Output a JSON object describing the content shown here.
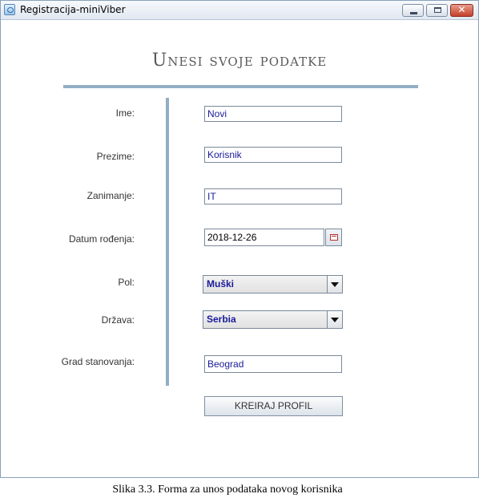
{
  "window": {
    "title": "Registracija-miniViber",
    "close_symbol": "✕"
  },
  "form": {
    "heading": "Unesi svoje podatke",
    "labels": {
      "ime": "Ime:",
      "prezime": "Prezime:",
      "zanimanje": "Zanimanje:",
      "datum": "Datum rođenja:",
      "pol": "Pol:",
      "drzava": "Država:",
      "grad": "Grad stanovanja:"
    },
    "values": {
      "ime": "Novi",
      "prezime": "Korisnik",
      "zanimanje": "IT",
      "datum": "2018-12-26",
      "pol": "Muški",
      "drzava": "Serbia",
      "grad": "Beograd"
    },
    "submit_label": "KREIRAJ PROFIL"
  },
  "caption": "Slika 3.3. Forma za unos podataka novog korisnika",
  "colors": {
    "accent_rule": "#92aec4",
    "value_text": "#1a1a9a"
  }
}
